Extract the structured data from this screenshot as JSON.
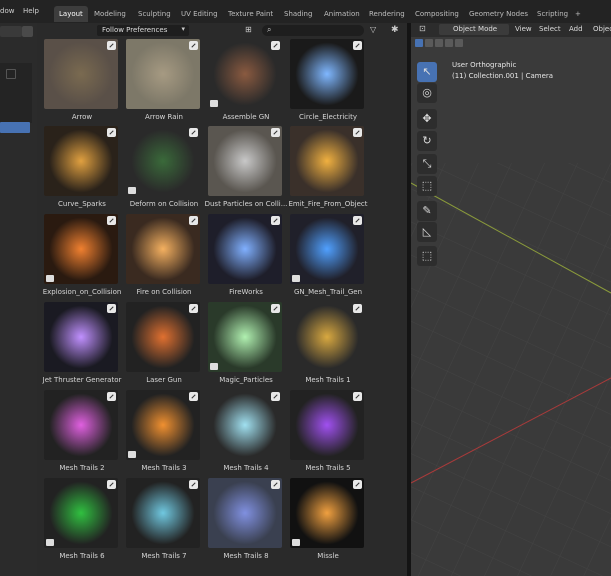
{
  "menu": {
    "window": "dow",
    "help": "Help"
  },
  "workspaces": [
    "Layout",
    "Modeling",
    "Sculpting",
    "UV Editing",
    "Texture Paint",
    "Shading",
    "Animation",
    "Rendering",
    "Compositing",
    "Geometry Nodes",
    "Scripting"
  ],
  "workspace_add": "+",
  "browser": {
    "filter_label": "Follow Preferences"
  },
  "assets": [
    {
      "label": "Arrow"
    },
    {
      "label": "Arrow Rain"
    },
    {
      "label": "Assemble GN"
    },
    {
      "label": "Circle_Electricity"
    },
    {
      "label": "Curve_Sparks"
    },
    {
      "label": "Deform on Collision"
    },
    {
      "label": "Dust Particles on Colli..."
    },
    {
      "label": "Emit_Fire_From_Object"
    },
    {
      "label": "Explosion_on_Collision"
    },
    {
      "label": "Fire on Collision"
    },
    {
      "label": "FireWorks"
    },
    {
      "label": "GN_Mesh_Trail_Gen"
    },
    {
      "label": "Jet Thruster Generator"
    },
    {
      "label": "Laser Gun"
    },
    {
      "label": "Magic_Particles"
    },
    {
      "label": "Mesh Trails 1"
    },
    {
      "label": "Mesh Trails 2"
    },
    {
      "label": "Mesh Trails 3"
    },
    {
      "label": "Mesh Trails 4"
    },
    {
      "label": "Mesh Trails 5"
    },
    {
      "label": "Mesh Trails 6"
    },
    {
      "label": "Mesh Trails 7"
    },
    {
      "label": "Mesh Trails 8"
    },
    {
      "label": "Missle"
    }
  ],
  "viewport": {
    "mode": "Object Mode",
    "menus": [
      "View",
      "Select",
      "Add",
      "Objec"
    ],
    "view_name": "User Orthographic",
    "collection": "(11) Collection.001 | Camera"
  },
  "tools": [
    "select-box-icon",
    "cursor-icon",
    "move-icon",
    "rotate-icon",
    "scale-icon",
    "transform-icon",
    "annotate-icon",
    "measure-icon",
    "add-cube-icon"
  ]
}
